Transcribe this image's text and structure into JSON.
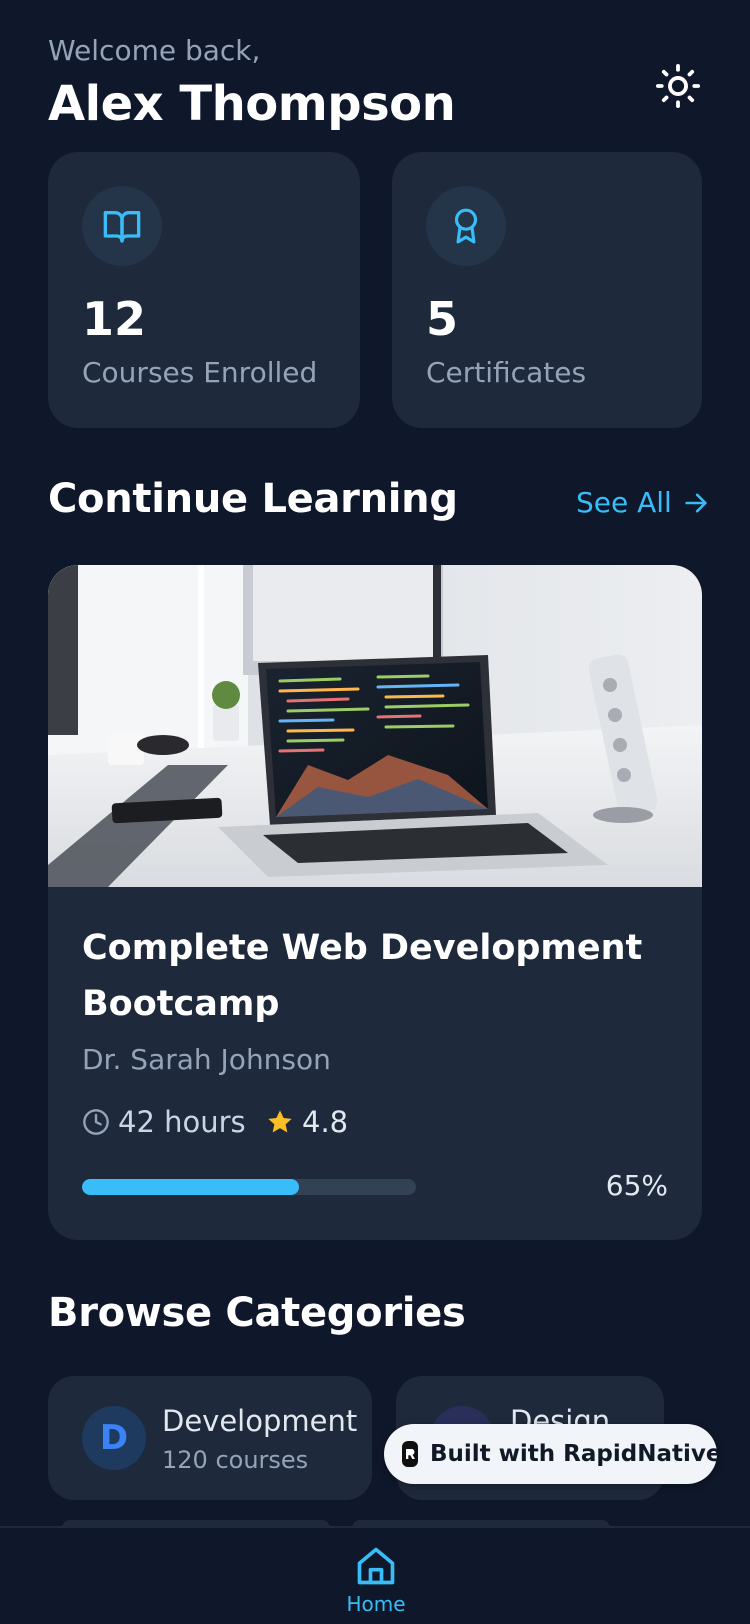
{
  "header": {
    "welcome": "Welcome back,",
    "user_name": "Alex Thompson",
    "theme_toggle_icon": "sun-icon"
  },
  "stats": [
    {
      "icon": "book-open-icon",
      "value": "12",
      "label": "Courses Enrolled"
    },
    {
      "icon": "award-icon",
      "value": "5",
      "label": "Certificates"
    }
  ],
  "continue_learning": {
    "title": "Continue Learning",
    "see_all": "See All",
    "course": {
      "image": "laptop-code-photo",
      "title": "Complete Web Development Bootcamp",
      "instructor": "Dr. Sarah Johnson",
      "hours": "42 hours",
      "rating": "4.8",
      "progress_label": "65%",
      "progress": 0.65
    }
  },
  "categories": {
    "title": "Browse Categories",
    "items": [
      {
        "initial": "D",
        "name": "Development",
        "count": "120 courses"
      },
      {
        "initial": "D",
        "name": "Design",
        "count": ""
      }
    ]
  },
  "badge": {
    "text": "Built with RapidNative"
  },
  "nav": {
    "home_label": "Home",
    "home_icon": "home-icon"
  },
  "colors": {
    "background": "#0f172a",
    "card": "#1e293b",
    "accent": "#38bdf8",
    "star": "#fbbf24",
    "muted": "#94a3b8"
  }
}
